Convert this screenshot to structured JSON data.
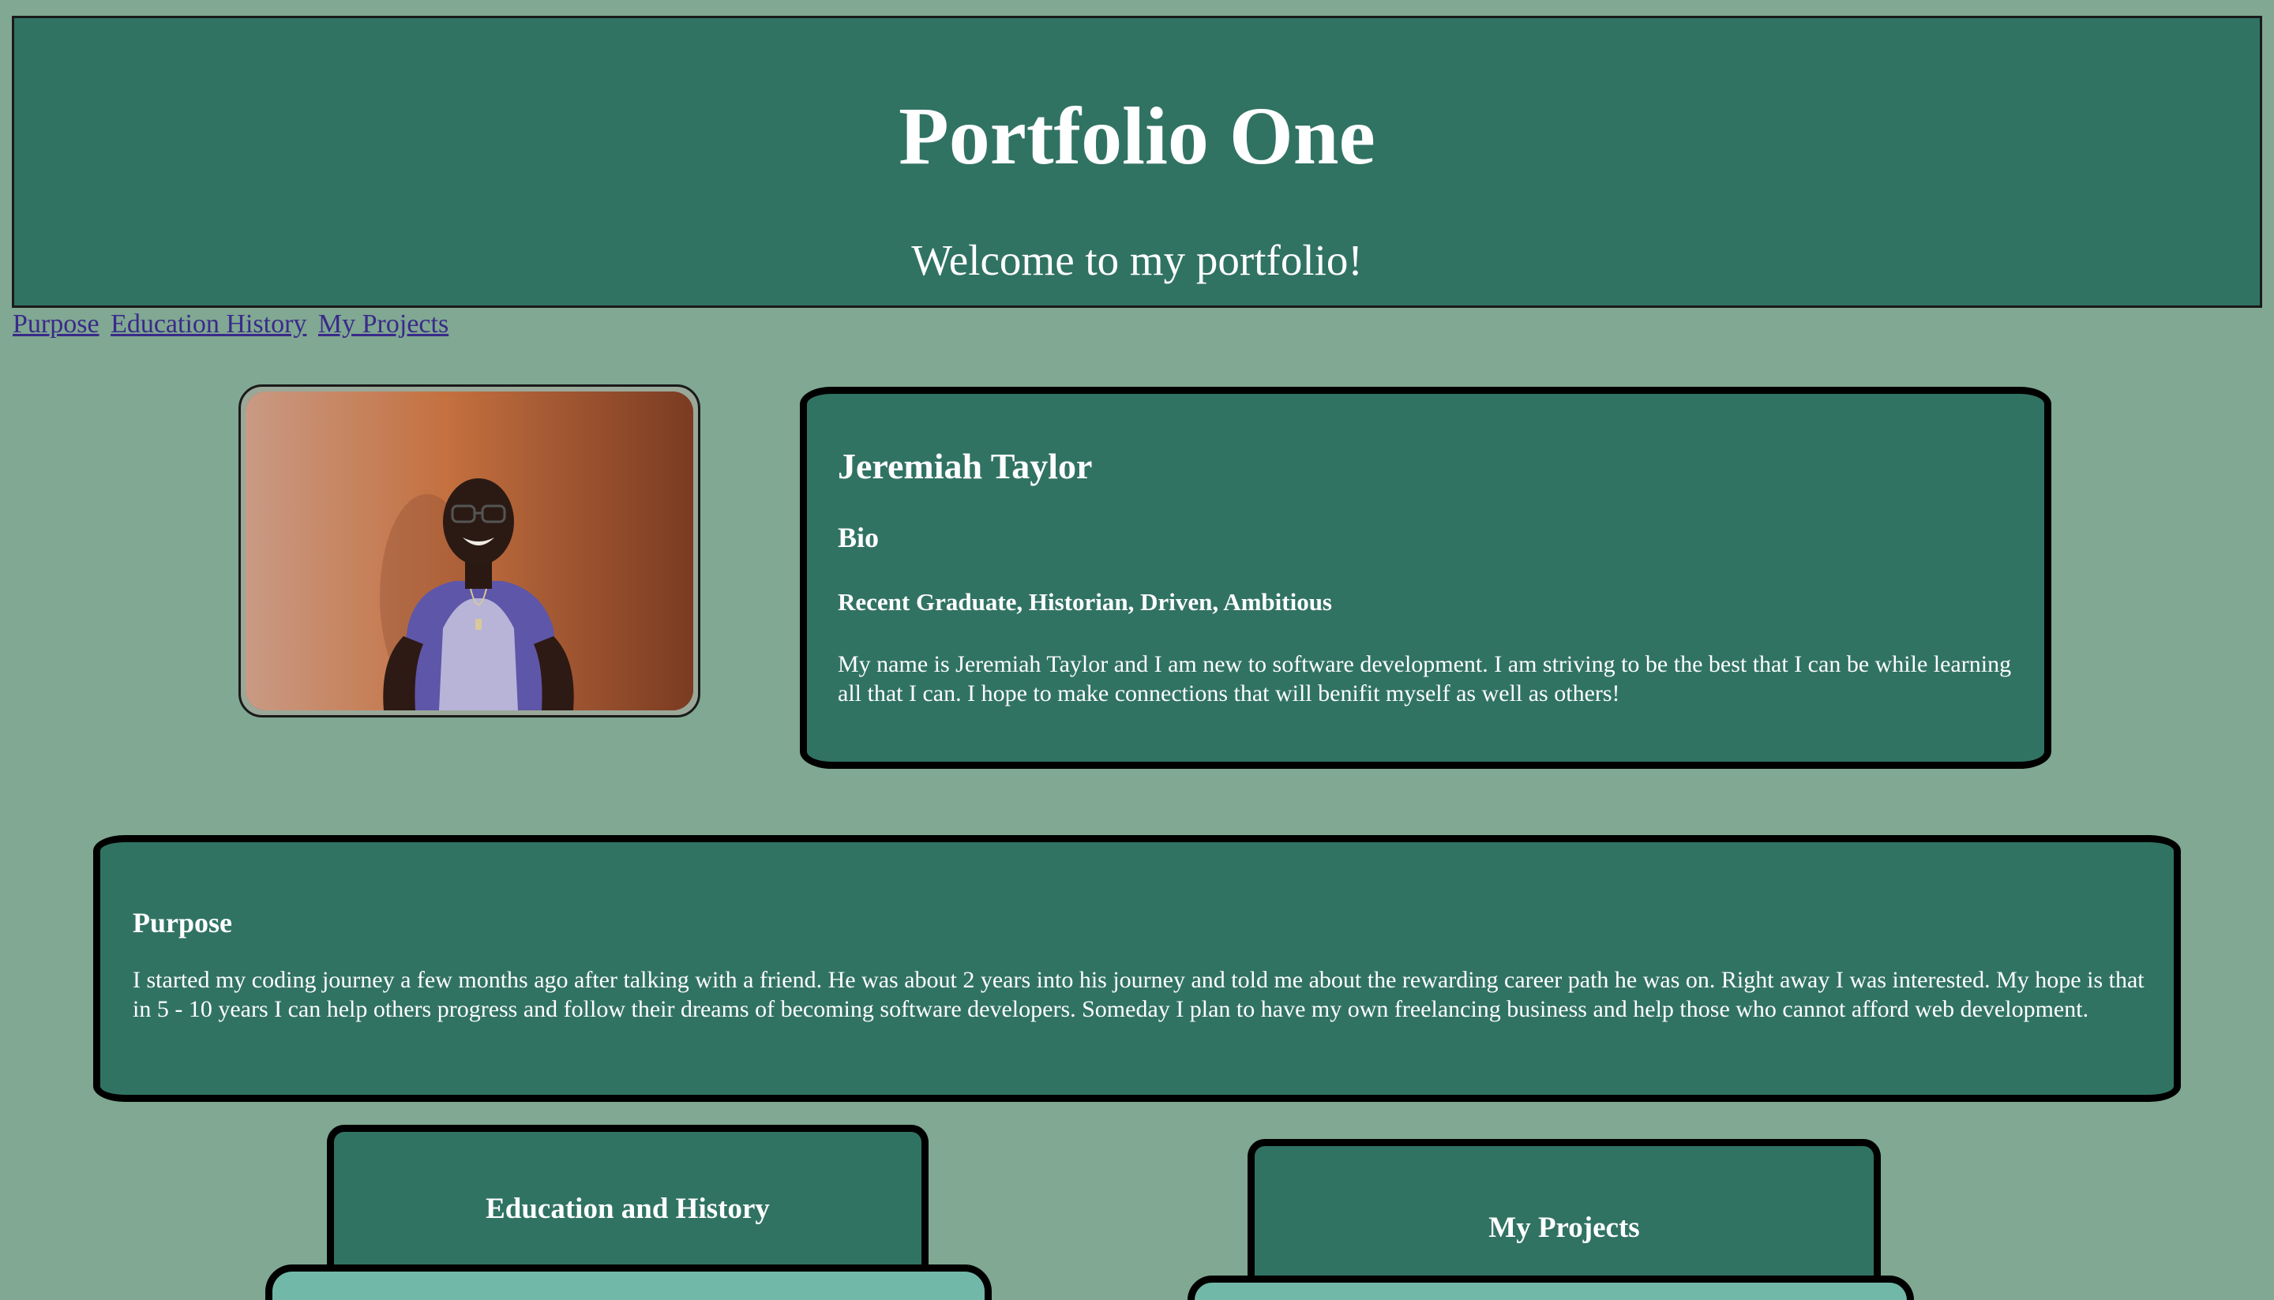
{
  "header": {
    "title": "Portfolio One",
    "subtitle": "Welcome to my portfolio!"
  },
  "nav": {
    "links": [
      "Purpose",
      "Education History",
      "My Projects"
    ]
  },
  "bio": {
    "name": "Jeremiah Taylor",
    "heading": "Bio",
    "tags": "Recent Graduate, Historian, Driven, Ambitious",
    "text": "My name is Jeremiah Taylor and I am new to software development. I am striving to be the best that I can be while learning all that I can. I hope to make connections that will benifit myself as well as others!"
  },
  "purpose": {
    "heading": "Purpose",
    "text": "I started my coding journey a few months ago after talking with a friend. He was about 2 years into his journey and told me about the rewarding career path he was on. Right away I was interested. My hope is that in 5 - 10 years I can help others progress and follow their dreams of becoming software developers. Someday I plan to have my own freelancing business and help those who cannot afford web development."
  },
  "sections": {
    "education": "Education and History",
    "projects": "My Projects"
  },
  "colors": {
    "page_background": "#80a892",
    "card_background": "#317363",
    "sub_card_background": "#72b8a8",
    "link": "#3a2a8a"
  }
}
